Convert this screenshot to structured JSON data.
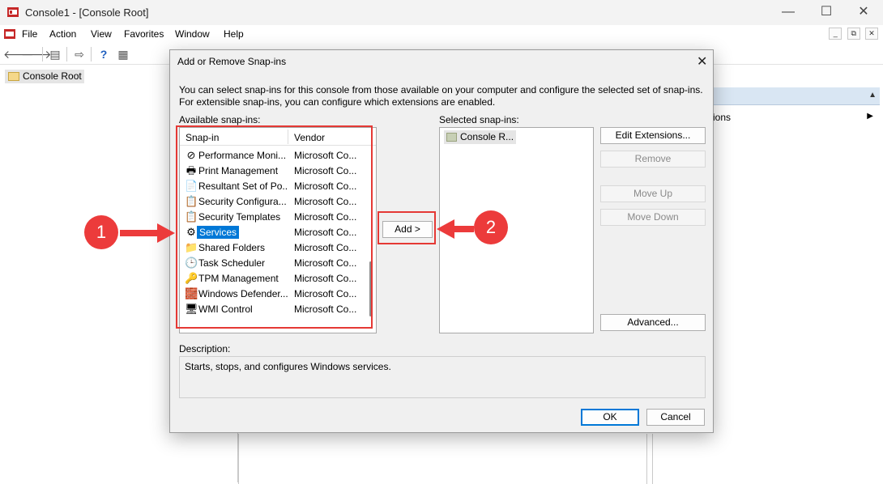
{
  "window": {
    "title": "Console1 - [Console Root]",
    "min_glyph": "—",
    "max_glyph": "☐",
    "close_glyph": "✕"
  },
  "menu": [
    "File",
    "Action",
    "View",
    "Favorites",
    "Window",
    "Help"
  ],
  "mdi": {
    "min": "_",
    "restore": "⧉",
    "close": "✕"
  },
  "tree": {
    "root_label": "Console Root"
  },
  "actions_pane": {
    "partial_label": "ions"
  },
  "dialog": {
    "title": "Add or Remove Snap-ins",
    "intro_line1": "You can select snap-ins for this console from those available on your computer and configure the selected set of snap-ins.",
    "intro_line2": "For extensible snap-ins, you can configure which extensions are enabled.",
    "available_label": "Available snap-ins:",
    "selected_label": "Selected snap-ins:",
    "columns": {
      "snapin": "Snap-in",
      "vendor": "Vendor"
    },
    "snapins": [
      {
        "name": "Performance Moni...",
        "vendor": "Microsoft Co...",
        "icon": "performance-monitor-icon",
        "glyph": "⊘"
      },
      {
        "name": "Print Management",
        "vendor": "Microsoft Co...",
        "icon": "printer-icon",
        "glyph": "🖶"
      },
      {
        "name": "Resultant Set of Po...",
        "vendor": "Microsoft Co...",
        "icon": "policy-icon",
        "glyph": "📄"
      },
      {
        "name": "Security Configura...",
        "vendor": "Microsoft Co...",
        "icon": "security-config-icon",
        "glyph": "📋"
      },
      {
        "name": "Security Templates",
        "vendor": "Microsoft Co...",
        "icon": "security-templates-icon",
        "glyph": "📋"
      },
      {
        "name": "Services",
        "vendor": "Microsoft Co...",
        "icon": "gear-icon",
        "glyph": "⚙"
      },
      {
        "name": "Shared Folders",
        "vendor": "Microsoft Co...",
        "icon": "shared-folder-icon",
        "glyph": "📁"
      },
      {
        "name": "Task Scheduler",
        "vendor": "Microsoft Co...",
        "icon": "clock-icon",
        "glyph": "🕒"
      },
      {
        "name": "TPM Management",
        "vendor": "Microsoft Co...",
        "icon": "tpm-chip-icon",
        "glyph": "🔑"
      },
      {
        "name": "Windows Defender...",
        "vendor": "Microsoft Co...",
        "icon": "firewall-icon",
        "glyph": "🧱"
      },
      {
        "name": "WMI Control",
        "vendor": "Microsoft Co...",
        "icon": "wmi-icon",
        "glyph": "🖥"
      }
    ],
    "selected_index": 5,
    "selected_items": [
      "Console R..."
    ],
    "buttons": {
      "add": "Add >",
      "edit_extensions": "Edit Extensions...",
      "remove": "Remove",
      "move_up": "Move Up",
      "move_down": "Move Down",
      "advanced": "Advanced...",
      "ok": "OK",
      "cancel": "Cancel"
    },
    "description_label": "Description:",
    "description_text": "Starts, stops, and configures Windows services."
  },
  "callouts": [
    "1",
    "2"
  ],
  "colors": {
    "accent": "#0078d7",
    "callout_red": "#ec3b3b"
  }
}
